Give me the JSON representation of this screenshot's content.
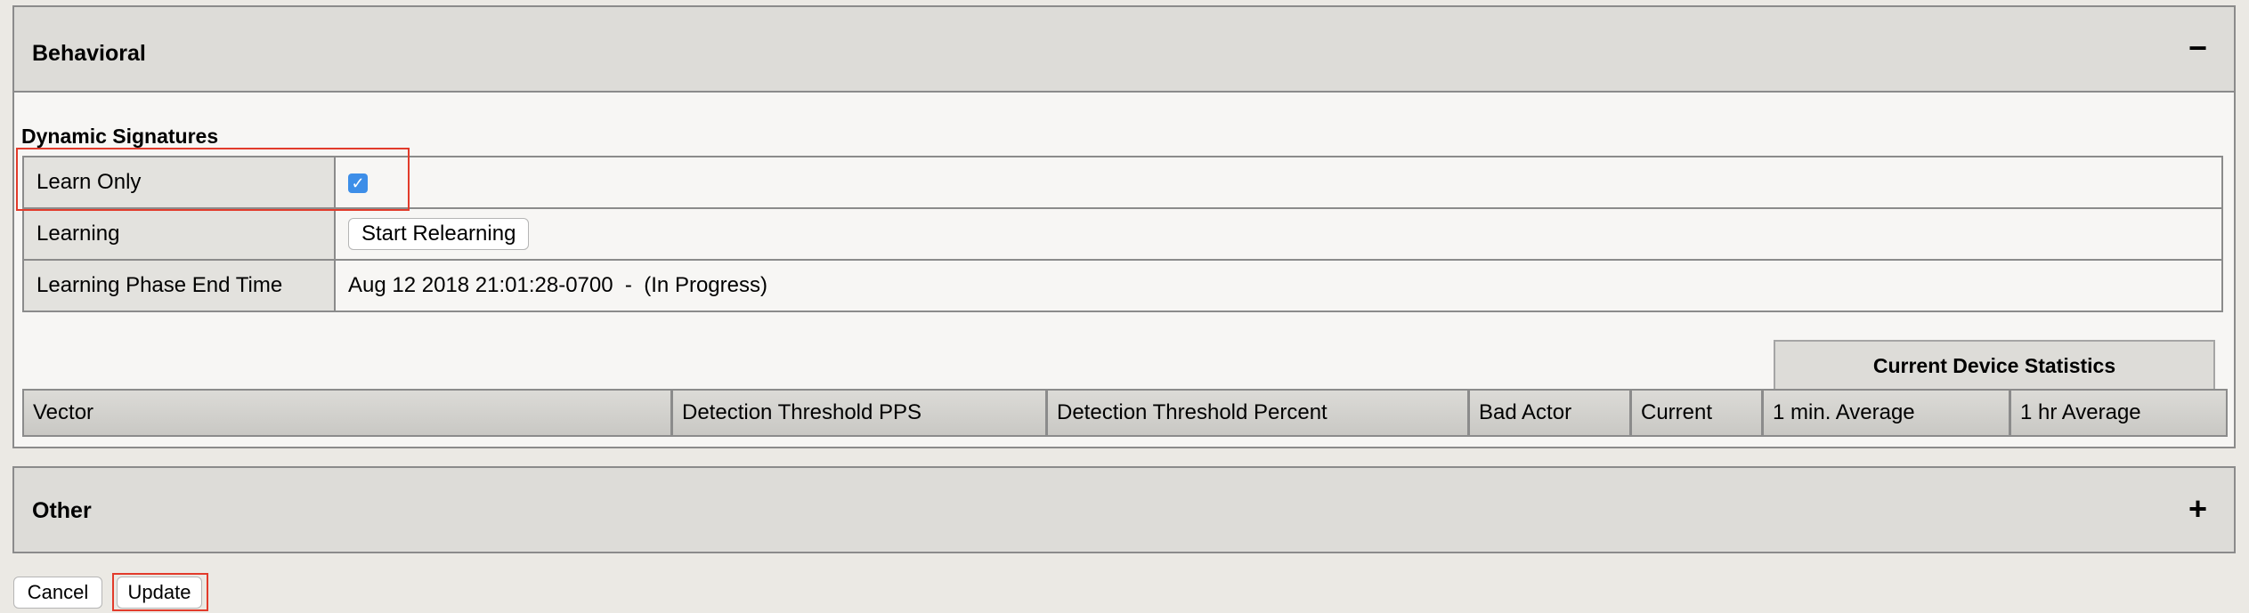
{
  "behavioral": {
    "title": "Behavioral",
    "collapse_symbol": "−",
    "section_title": "Dynamic Signatures",
    "rows": [
      {
        "label": "Learn Only",
        "checkbox_mark": "✓"
      },
      {
        "label": "Learning",
        "button_label": "Start Relearning"
      },
      {
        "label": "Learning Phase End Time",
        "value": "Aug 12 2018 21:01:28-0700  -  (In Progress)"
      }
    ],
    "stats_header": "Current Device Statistics",
    "columns": [
      "Vector",
      "Detection Threshold PPS",
      "Detection Threshold Percent",
      "Bad Actor",
      "Current",
      "1 min. Average",
      "1 hr Average"
    ]
  },
  "other": {
    "title": "Other",
    "expand_symbol": "+"
  },
  "footer": {
    "cancel_label": "Cancel",
    "update_label": "Update"
  },
  "colors": {
    "highlight": "#e23b2b",
    "checkbox": "#3d8ee8"
  }
}
